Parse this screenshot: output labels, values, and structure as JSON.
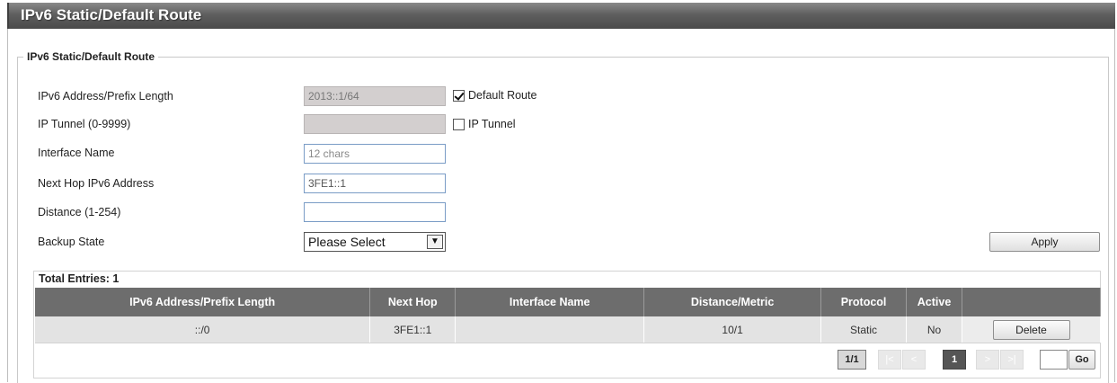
{
  "page": {
    "title": "IPv6 Static/Default Route",
    "section_legend": "IPv6 Static/Default Route"
  },
  "form": {
    "ipv6_prefix": {
      "label": "IPv6 Address/Prefix Length",
      "value": "2013::1/64"
    },
    "default_route": {
      "label": "Default Route",
      "checked": true
    },
    "ip_tunnel": {
      "label": "IP Tunnel (0-9999)",
      "value": ""
    },
    "ip_tunnel_check": {
      "label": "IP Tunnel",
      "checked": false
    },
    "interface_name": {
      "label": "Interface Name",
      "placeholder": "12 chars"
    },
    "next_hop": {
      "label": "Next Hop IPv6 Address",
      "value": "3FE1::1"
    },
    "distance": {
      "label": "Distance (1-254)",
      "value": ""
    },
    "backup_state": {
      "label": "Backup State",
      "selected": "Please Select"
    },
    "apply_label": "Apply"
  },
  "table": {
    "total_entries": "Total Entries: 1",
    "columns": [
      "IPv6 Address/Prefix Length",
      "Next Hop",
      "Interface Name",
      "Distance/Metric",
      "Protocol",
      "Active",
      ""
    ],
    "rows": [
      {
        "prefix": "::/0",
        "next_hop": "3FE1::1",
        "interface": "",
        "distance": "10/1",
        "protocol": "Static",
        "active": "No",
        "action": "Delete"
      }
    ]
  },
  "pagination": {
    "page_count": "1/1",
    "first": "|<",
    "prev": "<",
    "current": "1",
    "next": ">",
    "last": ">|",
    "go_label": "Go"
  }
}
